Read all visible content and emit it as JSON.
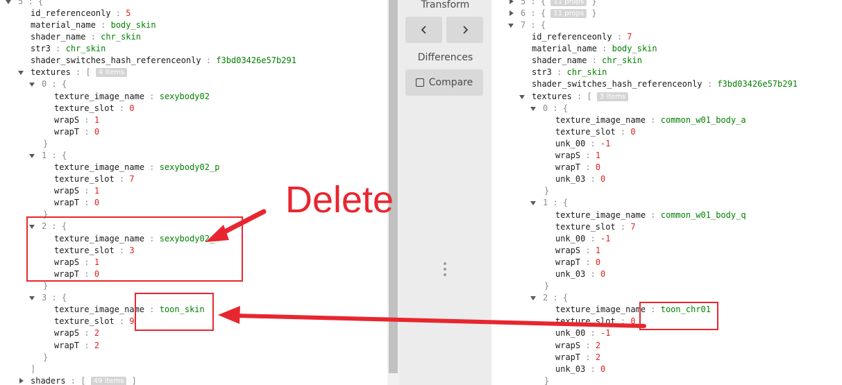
{
  "left": {
    "index_5": "5",
    "id_ref": {
      "key": "id_referenceonly",
      "value": "5"
    },
    "material_name": {
      "key": "material_name",
      "value": "body_skin"
    },
    "shader_name": {
      "key": "shader_name",
      "value": "chr_skin"
    },
    "str3": {
      "key": "str3",
      "value": "chr_skin"
    },
    "shader_hash": {
      "key": "shader_switches_hash_referenceonly",
      "value": "f3bd03426e57b291"
    },
    "textures": {
      "key": "textures",
      "badge": "4 items"
    },
    "items": [
      {
        "index": "0",
        "name": "sexybody02",
        "slot": "0",
        "wrapS": "1",
        "wrapT": "0"
      },
      {
        "index": "1",
        "name": "sexybody02_p",
        "slot": "7",
        "wrapS": "1",
        "wrapT": "0"
      },
      {
        "index": "2",
        "name": "sexybody02_n",
        "slot": "3",
        "wrapS": "1",
        "wrapT": "0"
      },
      {
        "index": "3",
        "name": "toon_skin",
        "slot": "9",
        "wrapS": "2",
        "wrapT": "2"
      }
    ],
    "shaders": {
      "key": "shaders",
      "badge": "49 items"
    }
  },
  "right": {
    "collapsed": [
      {
        "index": "5",
        "badge": "11 props"
      },
      {
        "index": "6",
        "badge": "11 props"
      }
    ],
    "index_7": "7",
    "id_ref": {
      "key": "id_referenceonly",
      "value": "7"
    },
    "material_name": {
      "key": "material_name",
      "value": "body_skin"
    },
    "shader_name": {
      "key": "shader_name",
      "value": "chr_skin"
    },
    "str3": {
      "key": "str3",
      "value": "chr_skin"
    },
    "shader_hash": {
      "key": "shader_switches_hash_referenceonly",
      "value": "f3bd03426e57b291"
    },
    "textures": {
      "key": "textures",
      "badge": "3 items"
    },
    "items": [
      {
        "index": "0",
        "name": "common_w01_body_a",
        "slot": "0",
        "unk_00": "-1",
        "wrapS": "1",
        "wrapT": "0",
        "unk_03": "0"
      },
      {
        "index": "1",
        "name": "common_w01_body_q",
        "slot": "7",
        "unk_00": "-1",
        "wrapS": "1",
        "wrapT": "0",
        "unk_03": "0"
      },
      {
        "index": "2",
        "name": "toon_chr01",
        "slot": "0",
        "unk_00": "-1",
        "wrapS": "2",
        "wrapT": "2",
        "unk_03": "0"
      }
    ]
  },
  "labels": {
    "texture_image_name": "texture_image_name",
    "texture_slot": "texture_slot",
    "wrapS": "wrapS",
    "wrapT": "wrapT",
    "unk_00": "unk_00",
    "unk_03": "unk_03"
  },
  "middle": {
    "transform_label": "Transform",
    "differences_label": "Differences",
    "compare_label": "Compare",
    "prev_icon": "chevron-left-icon",
    "next_icon": "chevron-right-icon",
    "drag_handle_icon": "vertical-dots-icon"
  },
  "annotation": {
    "text": "Delete",
    "color": "#e8262f"
  }
}
